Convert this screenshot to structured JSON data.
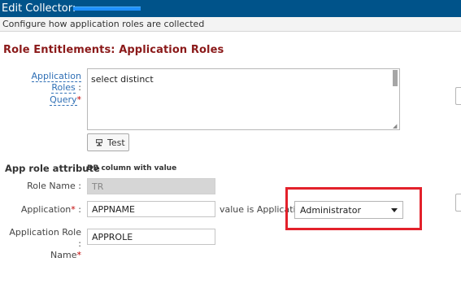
{
  "header": {
    "title": "Edit Collector:",
    "subtitle": "Configure how application roles are collected"
  },
  "section": {
    "title": "Role Entitlements: Application Roles"
  },
  "query": {
    "label_line1": "Application Roles",
    "label_line2": "Query",
    "colon": ":",
    "required": "*",
    "value": "select distinct",
    "test_button": "Test"
  },
  "attributes": {
    "heading": "App role attribute",
    "column_heading": "DB column with value",
    "role_name": {
      "label": "Role Name :",
      "value": "TR"
    },
    "application": {
      "label": "Application",
      "colon": ":",
      "required": "*",
      "value": "APPNAME",
      "suffix": "value is Application",
      "selected": "Administrator"
    },
    "application_role": {
      "label_line1": "Application Role :",
      "label_line2": "Name",
      "required": "*",
      "value": "APPROLE"
    }
  }
}
